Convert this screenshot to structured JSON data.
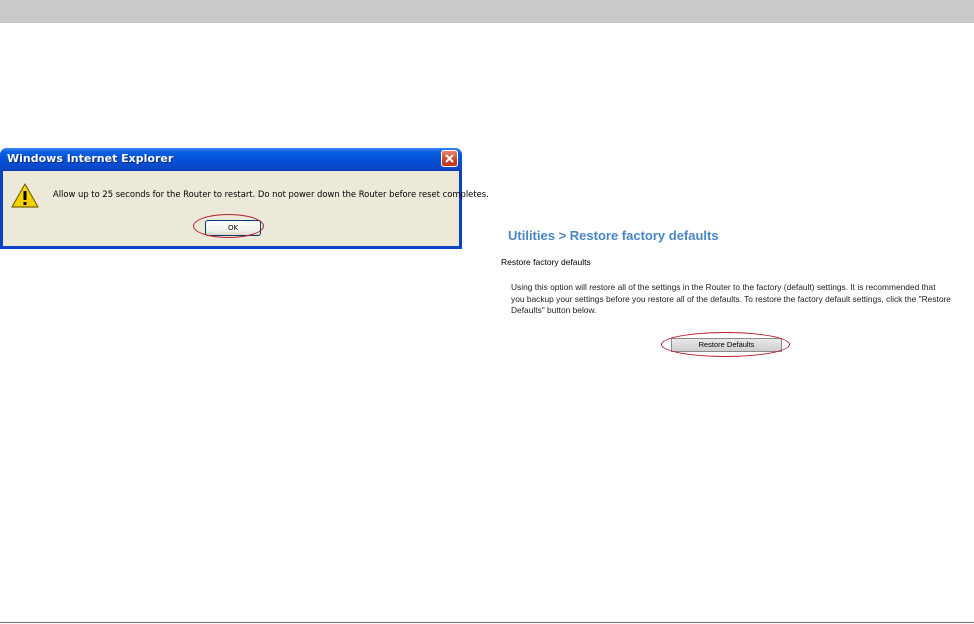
{
  "dialog": {
    "title": "Windows Internet Explorer",
    "message": "Allow up to 25 seconds for the Router to restart. Do not power down the Router before reset completes.",
    "ok_label": "OK",
    "icon": "warning-icon"
  },
  "router_page": {
    "title": "Utilities > Restore factory defaults",
    "section_label": "Restore factory defaults",
    "description": "Using this option will restore all of the settings in the Router to the factory (default) settings. It is recommended that you backup your settings before you restore all of the defaults. To restore the factory default settings, click the \"Restore Defaults\" button below.",
    "restore_button_label": "Restore Defaults"
  },
  "colors": {
    "title_blue": "#4a86c6",
    "highlight_red": "#b61f2a",
    "xp_title_blue": "#0550d8",
    "dialog_body": "#ece9d8"
  }
}
